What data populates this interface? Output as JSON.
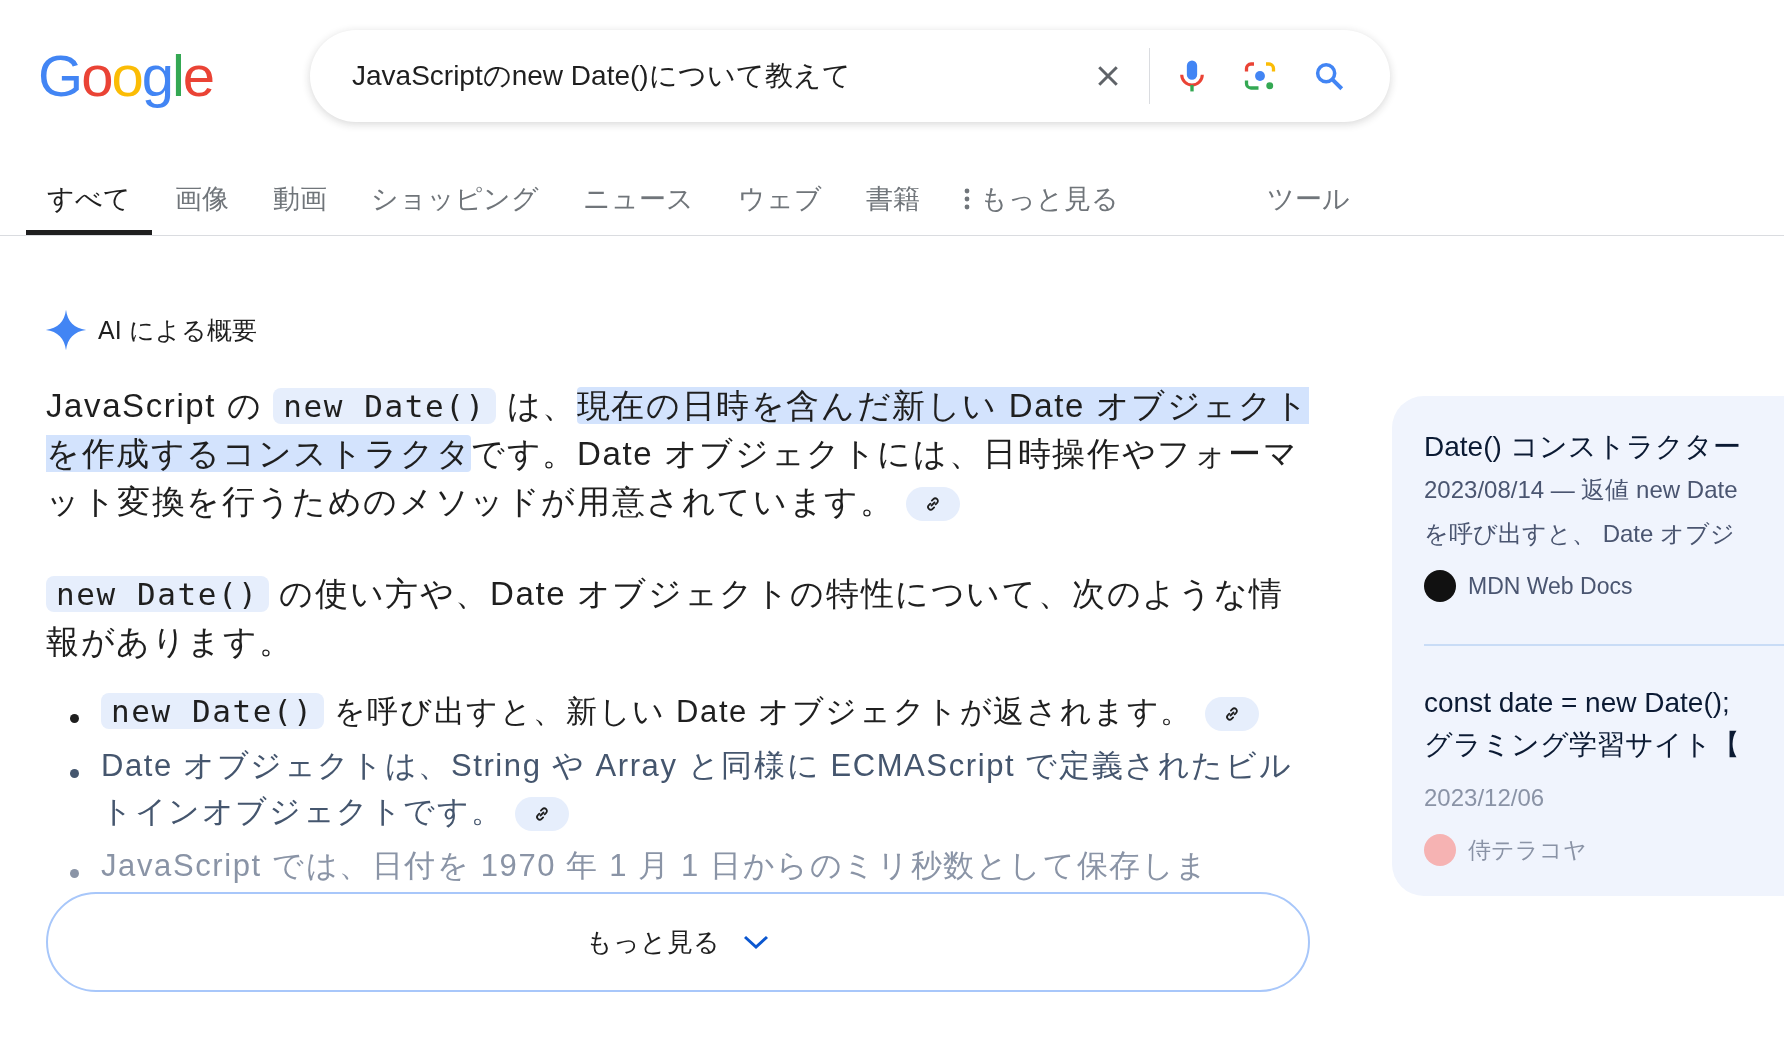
{
  "logo": "Google",
  "search": {
    "value": "JavaScriptのnew Date()について教えて"
  },
  "tabs": [
    {
      "label": "すべて",
      "selected": true,
      "kind": "plain"
    },
    {
      "label": "画像",
      "selected": false,
      "kind": "plain"
    },
    {
      "label": "動画",
      "selected": false,
      "kind": "plain"
    },
    {
      "label": "ショッピング",
      "selected": false,
      "kind": "plain"
    },
    {
      "label": "ニュース",
      "selected": false,
      "kind": "plain"
    },
    {
      "label": "ウェブ",
      "selected": false,
      "kind": "plain"
    },
    {
      "label": "書籍",
      "selected": false,
      "kind": "plain"
    },
    {
      "label": "もっと見る",
      "selected": false,
      "kind": "more"
    }
  ],
  "tools": "ツール",
  "overview": {
    "title": "AI による概要",
    "paragraphs": [
      {
        "segments": [
          {
            "kind": "text",
            "text": "JavaScript の "
          },
          {
            "kind": "code",
            "text": "new Date()"
          },
          {
            "kind": "text",
            "text": " は、"
          },
          {
            "kind": "highlight",
            "text": "現在の日時を含んだ新しい Date オブジェクトを作成するコンストラクタ"
          },
          {
            "kind": "text",
            "text": "です。Date オブジェクトには、日時操作やフォーマット変換を行うためのメソッドが用意されています。"
          }
        ],
        "link": true
      },
      {
        "segments": [
          {
            "kind": "code",
            "text": "new Date()"
          },
          {
            "kind": "text",
            "text": " の使い方や、Date オブジェクトの特性について、次のような情報があります。"
          }
        ],
        "link": false
      }
    ],
    "bullets": [
      {
        "segments": [
          {
            "kind": "code",
            "text": "new Date()"
          },
          {
            "kind": "text",
            "text": " を呼び出すと、新しい Date オブジェクトが返されます。"
          }
        ],
        "link": true
      },
      {
        "segments": [
          {
            "kind": "text",
            "text": "Date オブジェクトは、String や Array と同様に ECMAScript で定義されたビルトインオブジェクトです。"
          }
        ],
        "link": true
      },
      {
        "segments": [
          {
            "kind": "text",
            "text": "JavaScript では、日付を 1970 年 1 月 1 日からのミリ秒数として保存しま"
          }
        ],
        "link": false
      }
    ],
    "more_button": "もっと見る"
  },
  "sources": [
    {
      "title_lines": [
        "Date() コンストラクター"
      ],
      "snippet_lines": [
        "2023/08/14 — 返値 new Date",
        "を呼び出すと、 Date オブジ"
      ],
      "site": "MDN Web Docs",
      "color": "#111111"
    },
    {
      "title_lines": [
        "const date = new Date();",
        "グラミング学習サイト【"
      ],
      "snippet_lines": [
        "2023/12/06"
      ],
      "site": "侍テラコヤ",
      "color": "#f6b3b3"
    }
  ]
}
